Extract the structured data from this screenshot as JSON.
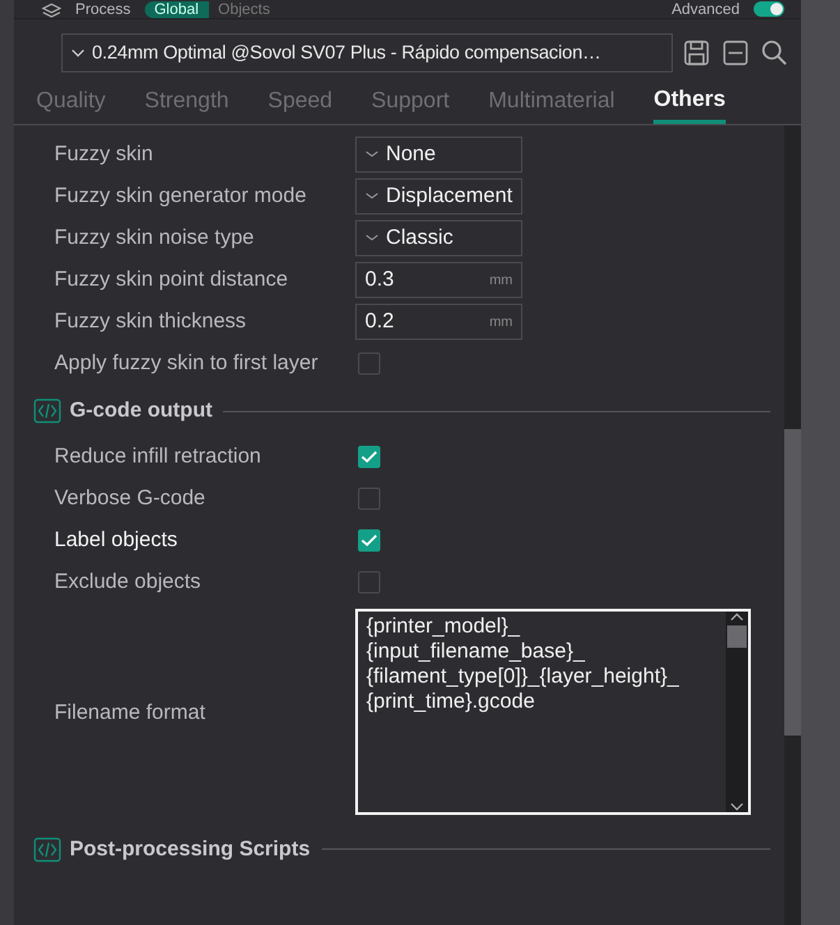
{
  "header": {
    "title": "Process",
    "scope_tabs": [
      {
        "label": "Global",
        "selected": true
      },
      {
        "label": "Objects",
        "selected": false
      }
    ],
    "advanced": {
      "label": "Advanced",
      "on": true
    }
  },
  "preset": {
    "value": "0.24mm Optimal @Sovol SV07 Plus - Rápido compensacion…"
  },
  "tabs": [
    {
      "label": "Quality",
      "selected": false
    },
    {
      "label": "Strength",
      "selected": false
    },
    {
      "label": "Speed",
      "selected": false
    },
    {
      "label": "Support",
      "selected": false
    },
    {
      "label": "Multimaterial",
      "selected": false
    },
    {
      "label": "Others",
      "selected": true
    }
  ],
  "sections": [
    {
      "rows": [
        {
          "kind": "dropdown",
          "label": "Fuzzy skin",
          "value": "None",
          "highlighted": false
        },
        {
          "kind": "dropdown",
          "label": "Fuzzy skin generator mode",
          "value": "Displacement",
          "highlighted": false
        },
        {
          "kind": "dropdown",
          "label": "Fuzzy skin noise type",
          "value": "Classic",
          "highlighted": false
        },
        {
          "kind": "number",
          "label": "Fuzzy skin point distance",
          "value": "0.3",
          "unit": "mm",
          "highlighted": false
        },
        {
          "kind": "number",
          "label": "Fuzzy skin thickness",
          "value": "0.2",
          "unit": "mm",
          "highlighted": false
        },
        {
          "kind": "checkbox",
          "label": "Apply fuzzy skin to first layer",
          "checked": false,
          "highlighted": false
        }
      ]
    },
    {
      "title": "G-code output",
      "rows": [
        {
          "kind": "checkbox",
          "label": "Reduce infill retraction",
          "checked": true,
          "highlighted": false
        },
        {
          "kind": "checkbox",
          "label": "Verbose G-code",
          "checked": false,
          "highlighted": false
        },
        {
          "kind": "checkbox",
          "label": "Label objects",
          "checked": true,
          "highlighted": true
        },
        {
          "kind": "checkbox",
          "label": "Exclude objects",
          "checked": false,
          "highlighted": false
        },
        {
          "kind": "textarea",
          "label": "Filename format",
          "value": "{printer_model}_\n{input_filename_base}_\n{filament_type[0]}_{layer_height}_\n{print_time}.gcode",
          "highlighted": false
        }
      ]
    },
    {
      "title": "Post-processing Scripts"
    }
  ]
}
